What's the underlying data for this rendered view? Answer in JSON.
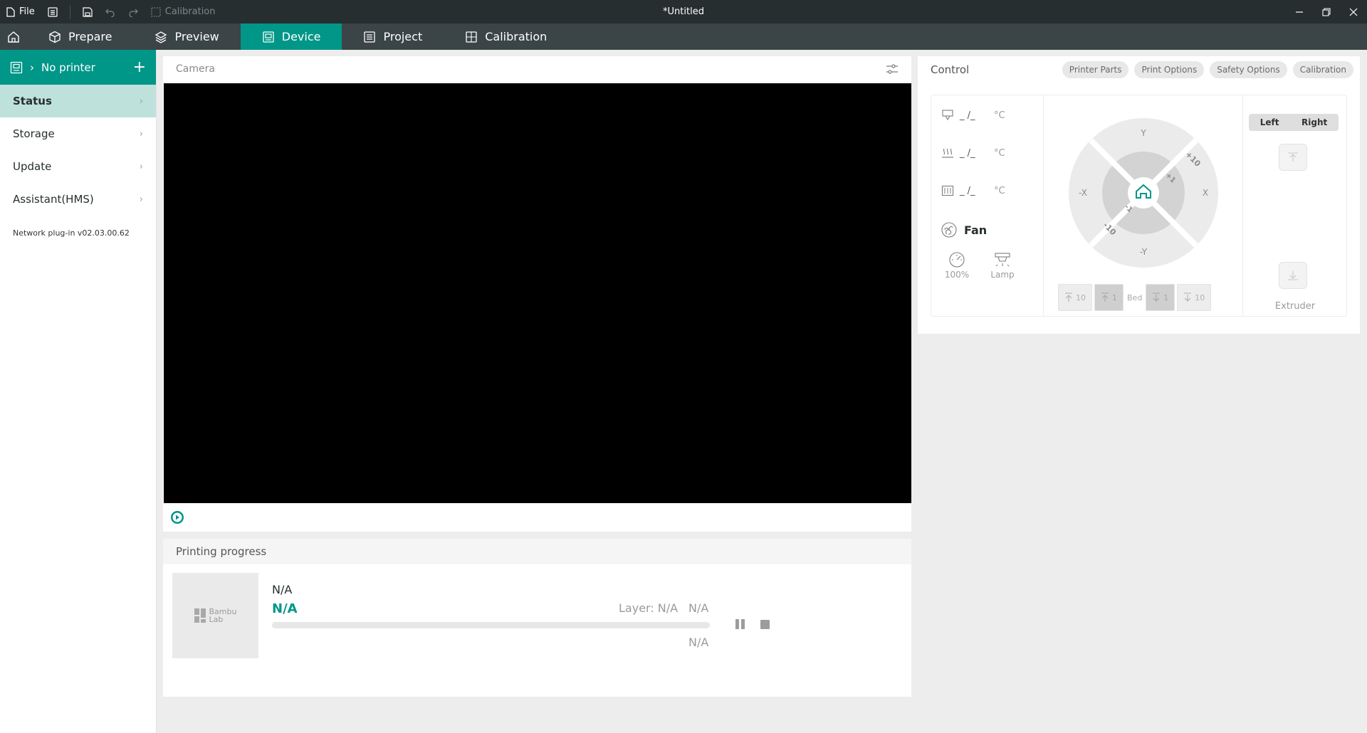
{
  "titlebar": {
    "file_label": "File",
    "calibration_label": "Calibration",
    "document_title": "*Untitled"
  },
  "nav": {
    "tabs": [
      {
        "label": "Prepare",
        "icon": "cube-icon"
      },
      {
        "label": "Preview",
        "icon": "layers-icon"
      },
      {
        "label": "Device",
        "icon": "device-icon",
        "active": true
      },
      {
        "label": "Project",
        "icon": "project-icon"
      },
      {
        "label": "Calibration",
        "icon": "calibration-icon"
      }
    ]
  },
  "sidebar": {
    "printer_name": "No printer",
    "items": [
      {
        "label": "Status",
        "active": true
      },
      {
        "label": "Storage"
      },
      {
        "label": "Update"
      },
      {
        "label": "Assistant(HMS)"
      }
    ],
    "plugin_version": "Network plug-in v02.03.00.62"
  },
  "camera": {
    "title": "Camera"
  },
  "progress": {
    "title": "Printing progress",
    "thumb_brand": [
      "Bambu",
      "Lab"
    ],
    "task_name": "N/A",
    "status": "N/A",
    "layer": "Layer: N/A",
    "percent": "N/A",
    "remaining": "N/A",
    "progress_fraction": 0
  },
  "control": {
    "title": "Control",
    "tabs": [
      "Printer Parts",
      "Print Options",
      "Safety Options",
      "Calibration"
    ],
    "temps": [
      {
        "icon": "nozzle-icon",
        "value": "_ /_",
        "unit": "°C"
      },
      {
        "icon": "heatbed-icon",
        "value": "_ /_",
        "unit": "°C"
      },
      {
        "icon": "chamber-icon",
        "value": "_ /_",
        "unit": "°C"
      }
    ],
    "fan_label": "Fan",
    "speed_label": "100%",
    "lamp_label": "Lamp",
    "jog": {
      "y_plus": "Y",
      "y_minus": "-Y",
      "x_plus": "X",
      "x_minus": "-X",
      "plus_10": "+10",
      "plus_1": "+1",
      "minus_1": "-1",
      "minus_10": "-10"
    },
    "bed": {
      "up10": "10",
      "up1": "1",
      "label": "Bed",
      "down1": "1",
      "down10": "10"
    },
    "extruder": {
      "left": "Left",
      "right": "Right",
      "label": "Extruder"
    }
  },
  "colors": {
    "accent": "#009688",
    "titlebar": "#262e30",
    "navbar": "#3b4446"
  }
}
